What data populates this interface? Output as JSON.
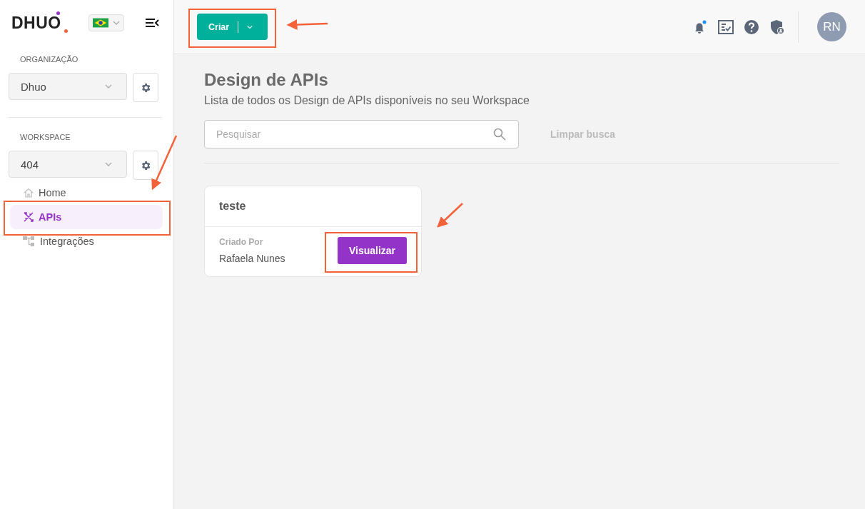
{
  "sidebar": {
    "logo": "DHUO",
    "organization": {
      "label": "ORGANIZAÇÃO",
      "value": "Dhuo"
    },
    "workspace": {
      "label": "WORKSPACE",
      "value": "404"
    },
    "nav": [
      {
        "label": "Home",
        "kind": "home",
        "selected": false
      },
      {
        "label": "APIs",
        "kind": "apis",
        "selected": true
      },
      {
        "label": "Integrações",
        "kind": "integrations",
        "selected": false
      }
    ]
  },
  "topbar": {
    "create_button": "Criar",
    "notifications": {
      "unread": true
    },
    "avatar": "RN"
  },
  "page": {
    "title": "Design de APIs",
    "subtitle": "Lista de todos os Design de APIs disponíveis no seu Workspace",
    "search": {
      "placeholder": "Pesquisar"
    },
    "clear_button": "Limpar busca",
    "cards": [
      {
        "title": "teste",
        "created_by_label": "Criado Por",
        "created_by": "Rafaela Nunes",
        "button": "Visualizar"
      }
    ]
  }
}
